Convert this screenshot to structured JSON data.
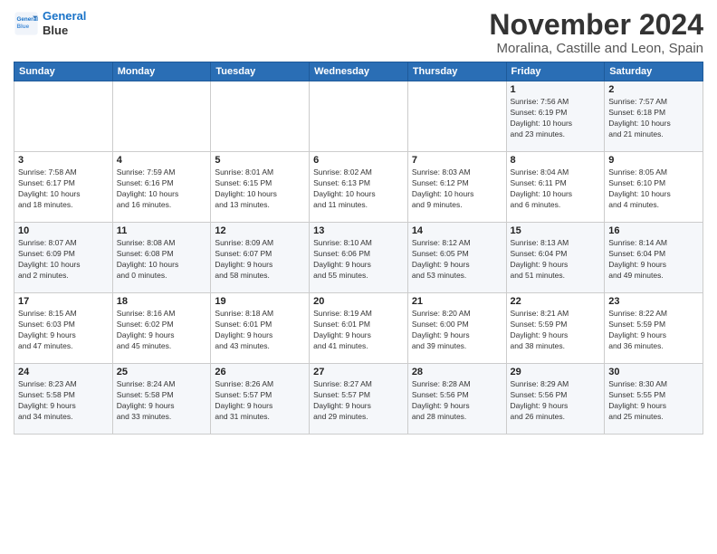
{
  "logo": {
    "line1": "General",
    "line2": "Blue"
  },
  "header": {
    "month": "November 2024",
    "location": "Moralina, Castille and Leon, Spain"
  },
  "weekdays": [
    "Sunday",
    "Monday",
    "Tuesday",
    "Wednesday",
    "Thursday",
    "Friday",
    "Saturday"
  ],
  "weeks": [
    [
      {
        "day": "",
        "info": ""
      },
      {
        "day": "",
        "info": ""
      },
      {
        "day": "",
        "info": ""
      },
      {
        "day": "",
        "info": ""
      },
      {
        "day": "",
        "info": ""
      },
      {
        "day": "1",
        "info": "Sunrise: 7:56 AM\nSunset: 6:19 PM\nDaylight: 10 hours\nand 23 minutes."
      },
      {
        "day": "2",
        "info": "Sunrise: 7:57 AM\nSunset: 6:18 PM\nDaylight: 10 hours\nand 21 minutes."
      }
    ],
    [
      {
        "day": "3",
        "info": "Sunrise: 7:58 AM\nSunset: 6:17 PM\nDaylight: 10 hours\nand 18 minutes."
      },
      {
        "day": "4",
        "info": "Sunrise: 7:59 AM\nSunset: 6:16 PM\nDaylight: 10 hours\nand 16 minutes."
      },
      {
        "day": "5",
        "info": "Sunrise: 8:01 AM\nSunset: 6:15 PM\nDaylight: 10 hours\nand 13 minutes."
      },
      {
        "day": "6",
        "info": "Sunrise: 8:02 AM\nSunset: 6:13 PM\nDaylight: 10 hours\nand 11 minutes."
      },
      {
        "day": "7",
        "info": "Sunrise: 8:03 AM\nSunset: 6:12 PM\nDaylight: 10 hours\nand 9 minutes."
      },
      {
        "day": "8",
        "info": "Sunrise: 8:04 AM\nSunset: 6:11 PM\nDaylight: 10 hours\nand 6 minutes."
      },
      {
        "day": "9",
        "info": "Sunrise: 8:05 AM\nSunset: 6:10 PM\nDaylight: 10 hours\nand 4 minutes."
      }
    ],
    [
      {
        "day": "10",
        "info": "Sunrise: 8:07 AM\nSunset: 6:09 PM\nDaylight: 10 hours\nand 2 minutes."
      },
      {
        "day": "11",
        "info": "Sunrise: 8:08 AM\nSunset: 6:08 PM\nDaylight: 10 hours\nand 0 minutes."
      },
      {
        "day": "12",
        "info": "Sunrise: 8:09 AM\nSunset: 6:07 PM\nDaylight: 9 hours\nand 58 minutes."
      },
      {
        "day": "13",
        "info": "Sunrise: 8:10 AM\nSunset: 6:06 PM\nDaylight: 9 hours\nand 55 minutes."
      },
      {
        "day": "14",
        "info": "Sunrise: 8:12 AM\nSunset: 6:05 PM\nDaylight: 9 hours\nand 53 minutes."
      },
      {
        "day": "15",
        "info": "Sunrise: 8:13 AM\nSunset: 6:04 PM\nDaylight: 9 hours\nand 51 minutes."
      },
      {
        "day": "16",
        "info": "Sunrise: 8:14 AM\nSunset: 6:04 PM\nDaylight: 9 hours\nand 49 minutes."
      }
    ],
    [
      {
        "day": "17",
        "info": "Sunrise: 8:15 AM\nSunset: 6:03 PM\nDaylight: 9 hours\nand 47 minutes."
      },
      {
        "day": "18",
        "info": "Sunrise: 8:16 AM\nSunset: 6:02 PM\nDaylight: 9 hours\nand 45 minutes."
      },
      {
        "day": "19",
        "info": "Sunrise: 8:18 AM\nSunset: 6:01 PM\nDaylight: 9 hours\nand 43 minutes."
      },
      {
        "day": "20",
        "info": "Sunrise: 8:19 AM\nSunset: 6:01 PM\nDaylight: 9 hours\nand 41 minutes."
      },
      {
        "day": "21",
        "info": "Sunrise: 8:20 AM\nSunset: 6:00 PM\nDaylight: 9 hours\nand 39 minutes."
      },
      {
        "day": "22",
        "info": "Sunrise: 8:21 AM\nSunset: 5:59 PM\nDaylight: 9 hours\nand 38 minutes."
      },
      {
        "day": "23",
        "info": "Sunrise: 8:22 AM\nSunset: 5:59 PM\nDaylight: 9 hours\nand 36 minutes."
      }
    ],
    [
      {
        "day": "24",
        "info": "Sunrise: 8:23 AM\nSunset: 5:58 PM\nDaylight: 9 hours\nand 34 minutes."
      },
      {
        "day": "25",
        "info": "Sunrise: 8:24 AM\nSunset: 5:58 PM\nDaylight: 9 hours\nand 33 minutes."
      },
      {
        "day": "26",
        "info": "Sunrise: 8:26 AM\nSunset: 5:57 PM\nDaylight: 9 hours\nand 31 minutes."
      },
      {
        "day": "27",
        "info": "Sunrise: 8:27 AM\nSunset: 5:57 PM\nDaylight: 9 hours\nand 29 minutes."
      },
      {
        "day": "28",
        "info": "Sunrise: 8:28 AM\nSunset: 5:56 PM\nDaylight: 9 hours\nand 28 minutes."
      },
      {
        "day": "29",
        "info": "Sunrise: 8:29 AM\nSunset: 5:56 PM\nDaylight: 9 hours\nand 26 minutes."
      },
      {
        "day": "30",
        "info": "Sunrise: 8:30 AM\nSunset: 5:55 PM\nDaylight: 9 hours\nand 25 minutes."
      }
    ]
  ]
}
